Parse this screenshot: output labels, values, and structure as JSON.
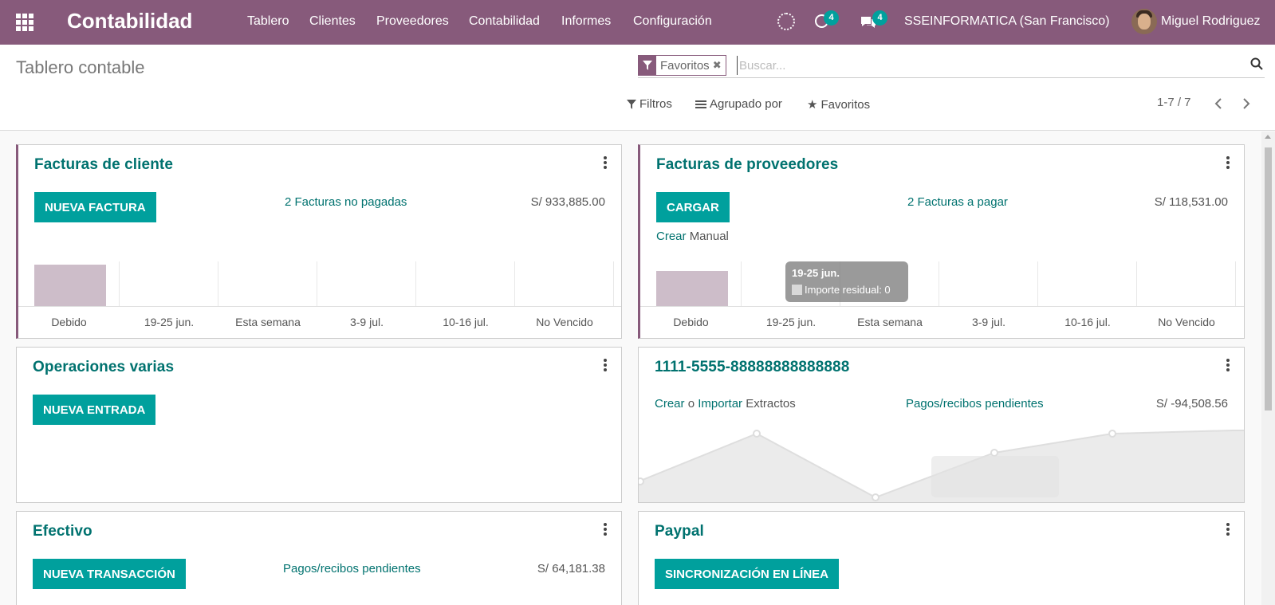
{
  "navbar": {
    "brand": "Contabilidad",
    "menu": [
      "Tablero",
      "Clientes",
      "Proveedores",
      "Contabilidad",
      "Informes",
      "Configuración"
    ],
    "activity_count": "4",
    "messages_count": "4",
    "company": "SSEINFORMATICA (San Francisco)",
    "user": "Miguel Rodriguez",
    "color": "#875a7b"
  },
  "control_panel": {
    "title": "Tablero contable",
    "facet_label": "Favoritos",
    "search_placeholder": "Buscar...",
    "filters_label": "Filtros",
    "group_by_label": "Agrupado por",
    "favorites_label": "Favoritos",
    "pager": "1-7 / 7"
  },
  "cards": {
    "customer_invoices": {
      "title": "Facturas de cliente",
      "button": "NUEVA FACTURA",
      "link": "2 Facturas no pagadas",
      "amount": "S/ 933,885.00",
      "chart_labels": [
        "Debido",
        "19-25 jun.",
        "Esta semana",
        "3-9 jul.",
        "10-16 jul.",
        "No Vencido"
      ]
    },
    "vendor_bills": {
      "title": "Facturas de proveedores",
      "button": "CARGAR",
      "link": "2 Facturas a pagar",
      "amount": "S/ 118,531.00",
      "create_link": "Crear",
      "create_suffix": "Manual",
      "chart_labels": [
        "Debido",
        "19-25 jun.",
        "Esta semana",
        "3-9 jul.",
        "10-16 jul.",
        "No Vencido"
      ],
      "tooltip_title": "19-25 jun.",
      "tooltip_text": "Importe residual: 0"
    },
    "misc": {
      "title": "Operaciones varias",
      "button": "NUEVA ENTRADA"
    },
    "bank": {
      "title": "1111-5555-88888888888888",
      "create_link": "Crear",
      "or_text": "o",
      "import_link": "Importar",
      "statements_text": "Extractos",
      "link": "Pagos/recibos pendientes",
      "amount": "S/ -94,508.56"
    },
    "cash": {
      "title": "Efectivo",
      "button": "NUEVA TRANSACCIÓN",
      "link": "Pagos/recibos pendientes",
      "amount": "S/ 64,181.38"
    },
    "paypal": {
      "title": "Paypal",
      "button": "SINCRONIZACIÓN EN LÍNEA"
    }
  }
}
